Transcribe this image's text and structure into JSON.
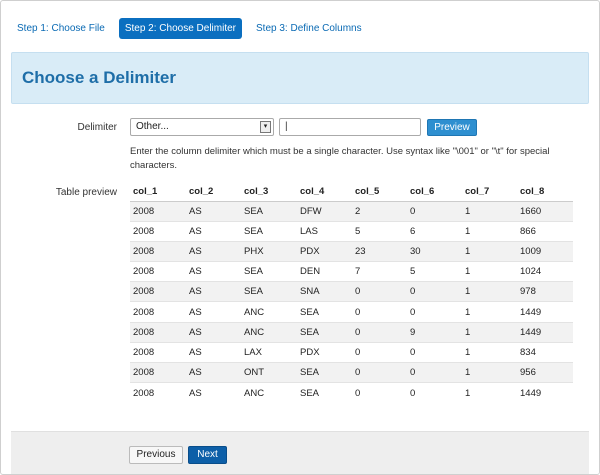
{
  "steps": [
    {
      "label": "Step 1: Choose File",
      "active": false
    },
    {
      "label": "Step 2: Choose Delimiter",
      "active": true
    },
    {
      "label": "Step 3: Define Columns",
      "active": false
    }
  ],
  "hero": {
    "title": "Choose a Delimiter"
  },
  "delimiter": {
    "label": "Delimiter",
    "select_value": "Other...",
    "input_value": "|",
    "preview_label": "Preview",
    "help": "Enter the column delimiter which must be a single character. Use syntax like \"\\001\" or \"\\t\" for special characters."
  },
  "table": {
    "label": "Table preview",
    "columns": [
      "col_1",
      "col_2",
      "col_3",
      "col_4",
      "col_5",
      "col_6",
      "col_7",
      "col_8"
    ],
    "rows": [
      [
        "2008",
        "AS",
        "SEA",
        "DFW",
        "2",
        "0",
        "1",
        "1660"
      ],
      [
        "2008",
        "AS",
        "SEA",
        "LAS",
        "5",
        "6",
        "1",
        "866"
      ],
      [
        "2008",
        "AS",
        "PHX",
        "PDX",
        "23",
        "30",
        "1",
        "1009"
      ],
      [
        "2008",
        "AS",
        "SEA",
        "DEN",
        "7",
        "5",
        "1",
        "1024"
      ],
      [
        "2008",
        "AS",
        "SEA",
        "SNA",
        "0",
        "0",
        "1",
        "978"
      ],
      [
        "2008",
        "AS",
        "ANC",
        "SEA",
        "0",
        "0",
        "1",
        "1449"
      ],
      [
        "2008",
        "AS",
        "ANC",
        "SEA",
        "0",
        "9",
        "1",
        "1449"
      ],
      [
        "2008",
        "AS",
        "LAX",
        "PDX",
        "0",
        "0",
        "1",
        "834"
      ],
      [
        "2008",
        "AS",
        "ONT",
        "SEA",
        "0",
        "0",
        "1",
        "956"
      ],
      [
        "2008",
        "AS",
        "ANC",
        "SEA",
        "0",
        "0",
        "1",
        "1449"
      ]
    ]
  },
  "footer": {
    "previous_label": "Previous",
    "next_label": "Next"
  }
}
